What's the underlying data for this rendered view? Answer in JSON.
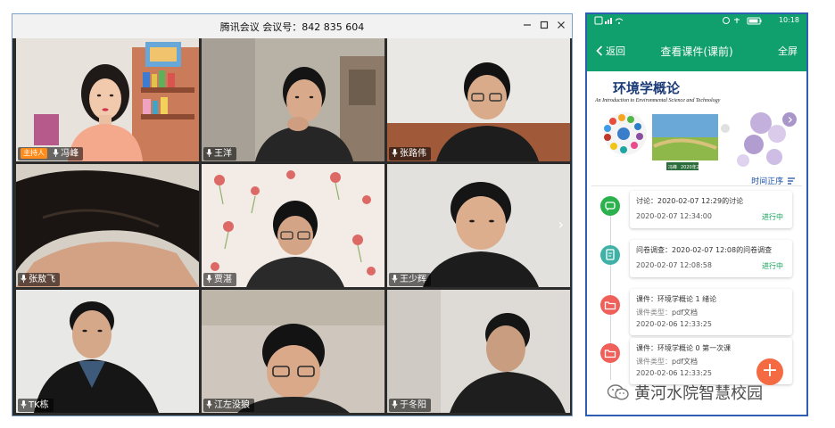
{
  "meeting": {
    "title": "腾讯会议  会议号：842 835 604",
    "host_badge": "主持人",
    "participants": [
      {
        "name": "冯峰"
      },
      {
        "name": "王洋"
      },
      {
        "name": "张路伟"
      },
      {
        "name": "张敖飞"
      },
      {
        "name": "贾湛"
      },
      {
        "name": "王少辉"
      },
      {
        "name": "TK栋"
      },
      {
        "name": "江左没狼"
      },
      {
        "name": "于冬阳"
      }
    ]
  },
  "phone": {
    "status_time": "10:18",
    "back_label": "返回",
    "page_title": "查看课件(课前)",
    "fullscreen_label": "全屏",
    "cover": {
      "title": "环境学概论",
      "subtitle": "An Introduction to Environmental Science and Technology",
      "author": "冯峰",
      "date": "2020年2月"
    },
    "sort_label": "时间正序",
    "items": [
      {
        "line1": "讨论：2020-02-07 12:29的讨论",
        "time": "2020-02-07 12:34:00",
        "status": "进行中",
        "icon_color": "#2bb24c"
      },
      {
        "line1": "问卷调查：2020-02-07 12:08的问卷调查",
        "time": "2020-02-07 12:08:58",
        "status": "进行中",
        "icon_color": "#3fb1a6"
      },
      {
        "line1": "课件：环境学概论 1 绪论",
        "type_label": "课件类型：",
        "type_value": "pdf文档",
        "time": "2020-02-06 12:33:25",
        "icon_color": "#f0605a"
      },
      {
        "line1": "课件：环境学概论 0 第一次课",
        "type_label": "课件类型：",
        "type_value": "pdf文档",
        "time": "2020-02-06 12:33:25",
        "icon_color": "#f0605a"
      }
    ]
  },
  "watermark": {
    "text": "黄河水院智慧校园"
  }
}
